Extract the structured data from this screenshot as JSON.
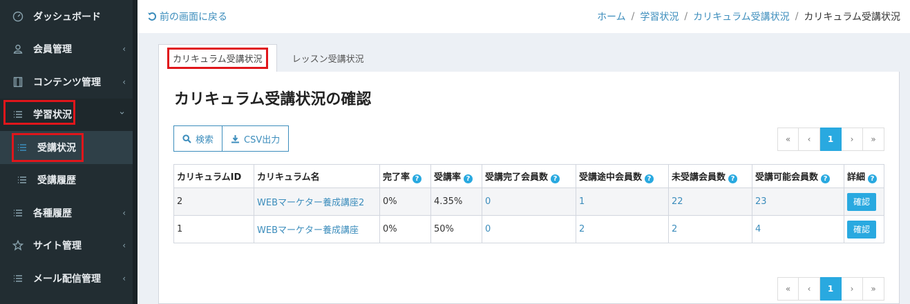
{
  "sidebar": {
    "items": [
      {
        "label": "ダッシュボード",
        "icon": "dashboard-icon",
        "chevron": ""
      },
      {
        "label": "会員管理",
        "icon": "users-icon",
        "chevron": "‹"
      },
      {
        "label": "コンテンツ管理",
        "icon": "film-icon",
        "chevron": "‹"
      },
      {
        "label": "学習状況",
        "icon": "list-icon",
        "chevron": "⌄"
      }
    ],
    "sub_items": [
      {
        "label": "受講状況",
        "icon": "list-icon"
      },
      {
        "label": "受講履歴",
        "icon": "list-icon"
      }
    ],
    "lower_items": [
      {
        "label": "各種履歴",
        "icon": "list-icon",
        "chevron": "‹"
      },
      {
        "label": "サイト管理",
        "icon": "star-icon",
        "chevron": "‹"
      },
      {
        "label": "メール配信管理",
        "icon": "list-icon",
        "chevron": "‹"
      }
    ]
  },
  "topbar": {
    "back_label": "前の画面に戻る",
    "breadcrumb": [
      "ホーム",
      "学習状況",
      "カリキュラム受講状況",
      "カリキュラム受講状況"
    ],
    "separator": "/"
  },
  "tabs": [
    "カリキュラム受講状況",
    "レッスン受講状況"
  ],
  "page_title": "カリキュラム受講状況の確認",
  "buttons": {
    "search": "検索",
    "csv": "CSV出力"
  },
  "pager": {
    "first": "«",
    "prev": "‹",
    "current": "1",
    "next": "›",
    "last": "»"
  },
  "table": {
    "headers": [
      "カリキュラムID",
      "カリキュラム名",
      "完了率",
      "受講率",
      "受講完了会員数",
      "受講途中会員数",
      "未受講会員数",
      "受講可能会員数",
      "詳細"
    ],
    "help_mark": "?",
    "rows": [
      {
        "id": "2",
        "name": "WEBマーケター養成講座2",
        "complete_rate": "0%",
        "attend_rate": "4.35%",
        "completed": "0",
        "in_progress": "1",
        "not_started": "22",
        "eligible": "23",
        "detail": "確認"
      },
      {
        "id": "1",
        "name": "WEBマーケター養成講座",
        "complete_rate": "0%",
        "attend_rate": "50%",
        "completed": "0",
        "in_progress": "2",
        "not_started": "2",
        "eligible": "4",
        "detail": "確認"
      }
    ]
  },
  "colors": {
    "accent": "#3c8dbc",
    "button_blue": "#29a9e0",
    "highlight_red": "#e0161b",
    "sidebar_bg": "#222d32"
  }
}
